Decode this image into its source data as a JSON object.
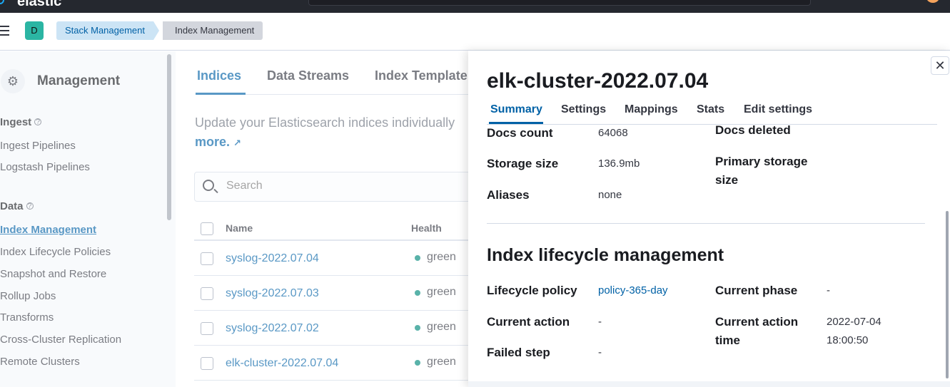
{
  "topbar": {
    "logo_text": "elastic"
  },
  "breadcrumbs": {
    "space_initial": "D",
    "items": [
      "Stack Management",
      "Index Management"
    ]
  },
  "sidebar": {
    "title": "Management",
    "groups": [
      {
        "label": "Ingest",
        "items": [
          "Ingest Pipelines",
          "Logstash Pipelines"
        ]
      },
      {
        "label": "Data",
        "items": [
          "Index Management",
          "Index Lifecycle Policies",
          "Snapshot and Restore",
          "Rollup Jobs",
          "Transforms",
          "Cross-Cluster Replication",
          "Remote Clusters"
        ]
      }
    ],
    "active_item": "Index Management"
  },
  "main": {
    "tabs": [
      "Indices",
      "Data Streams",
      "Index Template"
    ],
    "description": "Update your Elasticsearch indices individually",
    "learn_more": "more.",
    "search_placeholder": "Search",
    "columns": {
      "name": "Name",
      "health": "Health"
    },
    "rows": [
      {
        "name": "syslog-2022.07.04",
        "health": "green"
      },
      {
        "name": "syslog-2022.07.03",
        "health": "green"
      },
      {
        "name": "syslog-2022.07.02",
        "health": "green"
      },
      {
        "name": "elk-cluster-2022.07.04",
        "health": "green"
      }
    ]
  },
  "flyout": {
    "title": "elk-cluster-2022.07.04",
    "tabs": [
      "Summary",
      "Settings",
      "Mappings",
      "Stats",
      "Edit settings"
    ],
    "active_tab": "Summary",
    "summary": {
      "docs_count_label": "Docs count",
      "docs_count": "64068",
      "docs_deleted_label": "Docs deleted",
      "storage_size_label": "Storage size",
      "storage_size": "136.9mb",
      "primary_storage_label": "Primary storage size",
      "aliases_label": "Aliases",
      "aliases": "none"
    },
    "ilm": {
      "title": "Index lifecycle management",
      "lifecycle_policy_label": "Lifecycle policy",
      "lifecycle_policy": "policy-365-day",
      "current_phase_label": "Current phase",
      "current_phase": "-",
      "current_action_label": "Current action",
      "current_action": "-",
      "current_action_time_label": "Current action time",
      "current_action_time": "2022-07-04 18:00:50",
      "failed_step_label": "Failed step",
      "failed_step": "-"
    }
  },
  "colors": {
    "accent": "#0061a6",
    "health_green": "#00897b",
    "space_badge": "#2bb5a3"
  }
}
